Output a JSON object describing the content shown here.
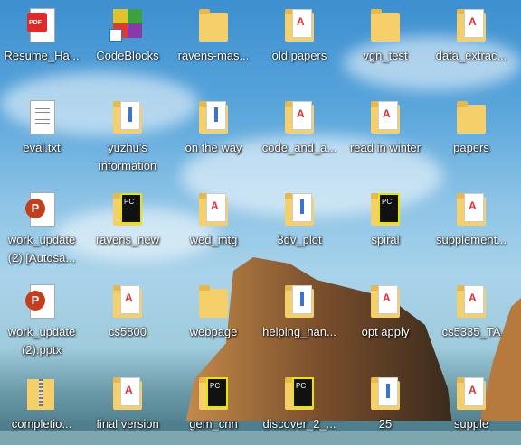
{
  "desktop": {
    "icons": [
      {
        "label": "Resume_Ha...",
        "type": "pdf"
      },
      {
        "label": "CodeBlocks",
        "type": "exe"
      },
      {
        "label": "ravens-mas...",
        "type": "folder"
      },
      {
        "label": "old papers",
        "type": "folder-pdf"
      },
      {
        "label": "vgn_test",
        "type": "folder"
      },
      {
        "label": "data_extrac...",
        "type": "folder-pdf"
      },
      {
        "label": "eval.txt",
        "type": "txt"
      },
      {
        "label": "yuzhu's information",
        "type": "folder-doc"
      },
      {
        "label": "on the way",
        "type": "folder-doc"
      },
      {
        "label": "code_and_a...",
        "type": "folder-pdf"
      },
      {
        "label": "read in winter",
        "type": "folder-pdf"
      },
      {
        "label": "papers",
        "type": "folder"
      },
      {
        "label": "work_update (2) [Autosa...",
        "type": "pptx"
      },
      {
        "label": "ravens_new",
        "type": "folder-pc"
      },
      {
        "label": "wed_mtg",
        "type": "folder-pdf"
      },
      {
        "label": "3dv_plot",
        "type": "folder-doc"
      },
      {
        "label": "spiral",
        "type": "folder-pc"
      },
      {
        "label": "supplement...",
        "type": "folder-pdf"
      },
      {
        "label": "work_update (2).pptx",
        "type": "pptx"
      },
      {
        "label": "cs5800",
        "type": "folder-pdf"
      },
      {
        "label": "webpage",
        "type": "folder"
      },
      {
        "label": "helping_han...",
        "type": "folder-doc"
      },
      {
        "label": "opt apply",
        "type": "folder-pdf"
      },
      {
        "label": "cs5335_TA",
        "type": "folder-pdf"
      },
      {
        "label": "completio...",
        "type": "zip"
      },
      {
        "label": "final version",
        "type": "folder-pdf"
      },
      {
        "label": "gem_cnn",
        "type": "folder-pc"
      },
      {
        "label": "discover_2_...",
        "type": "folder-pc"
      },
      {
        "label": "25",
        "type": "folder-doc"
      },
      {
        "label": "supple",
        "type": "folder-pdf"
      }
    ]
  }
}
